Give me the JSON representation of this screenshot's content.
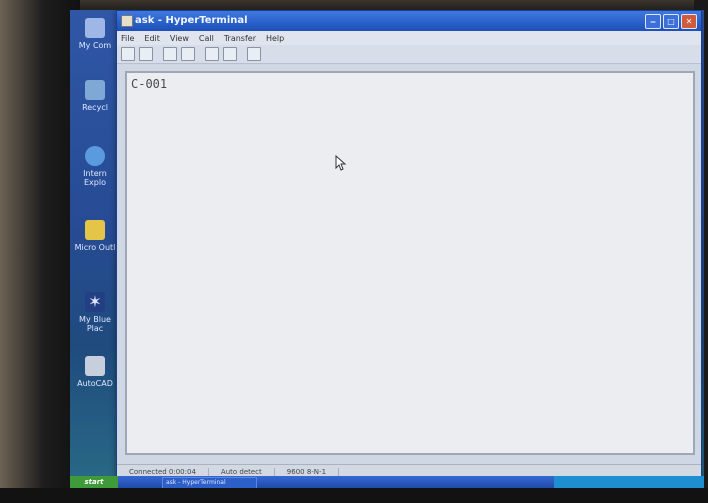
{
  "window": {
    "title": "ask - HyperTerminal"
  },
  "menu": [
    "File",
    "Edit",
    "View",
    "Call",
    "Transfer",
    "Help"
  ],
  "terminal": {
    "text": "C-001"
  },
  "status": {
    "connected": "Connected 0:00:04",
    "detect": "Auto detect",
    "params": "9600 8-N-1"
  },
  "desktop_icons": [
    {
      "label": "My Com",
      "icon": "computer-icon"
    },
    {
      "label": "Recycl",
      "icon": "recycle-bin-icon"
    },
    {
      "label": "Intern Explo",
      "icon": "internet-explorer-icon"
    },
    {
      "label": "Micro Outl",
      "icon": "outlook-icon"
    },
    {
      "label": "My Blue Plac",
      "icon": "bluetooth-icon"
    },
    {
      "label": "AutoCAD",
      "icon": "autocad-icon"
    }
  ],
  "taskbar": {
    "start": "start",
    "task": "ask - HyperTerminal"
  }
}
